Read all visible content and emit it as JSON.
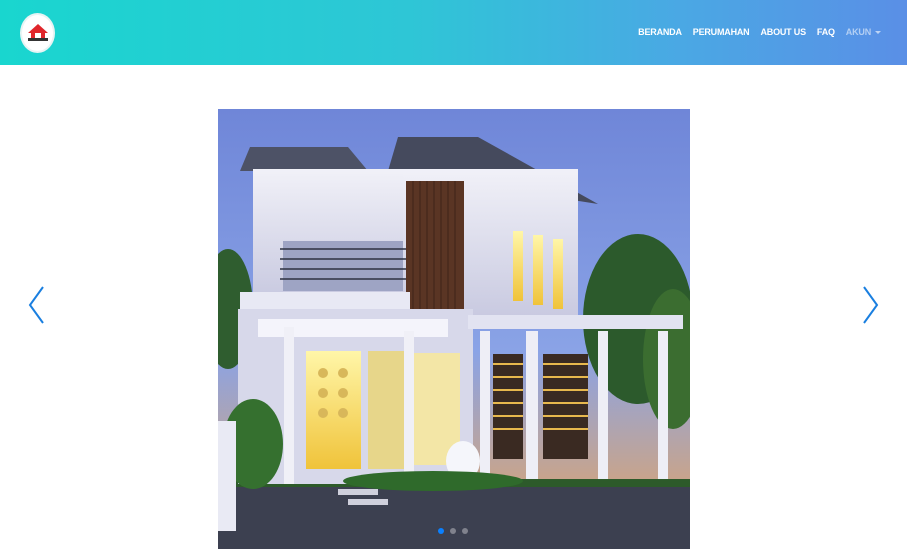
{
  "brand": {
    "logo_icon": "house-logo-icon"
  },
  "nav": {
    "items": [
      {
        "label": "BERANDA"
      },
      {
        "label": "PERUMAHAN"
      },
      {
        "label": "ABOUT US"
      },
      {
        "label": "FAQ"
      }
    ],
    "account": {
      "label": "AKUN",
      "icon": "caret-down-icon"
    }
  },
  "carousel": {
    "prev_icon": "chevron-left-icon",
    "next_icon": "chevron-right-icon",
    "slide_count": 3,
    "active_slide": 1,
    "accent_color": "#0a80ff"
  },
  "colors": {
    "nav_gradient_start": "#19d6cf",
    "nav_gradient_end": "#5a8fe6"
  }
}
